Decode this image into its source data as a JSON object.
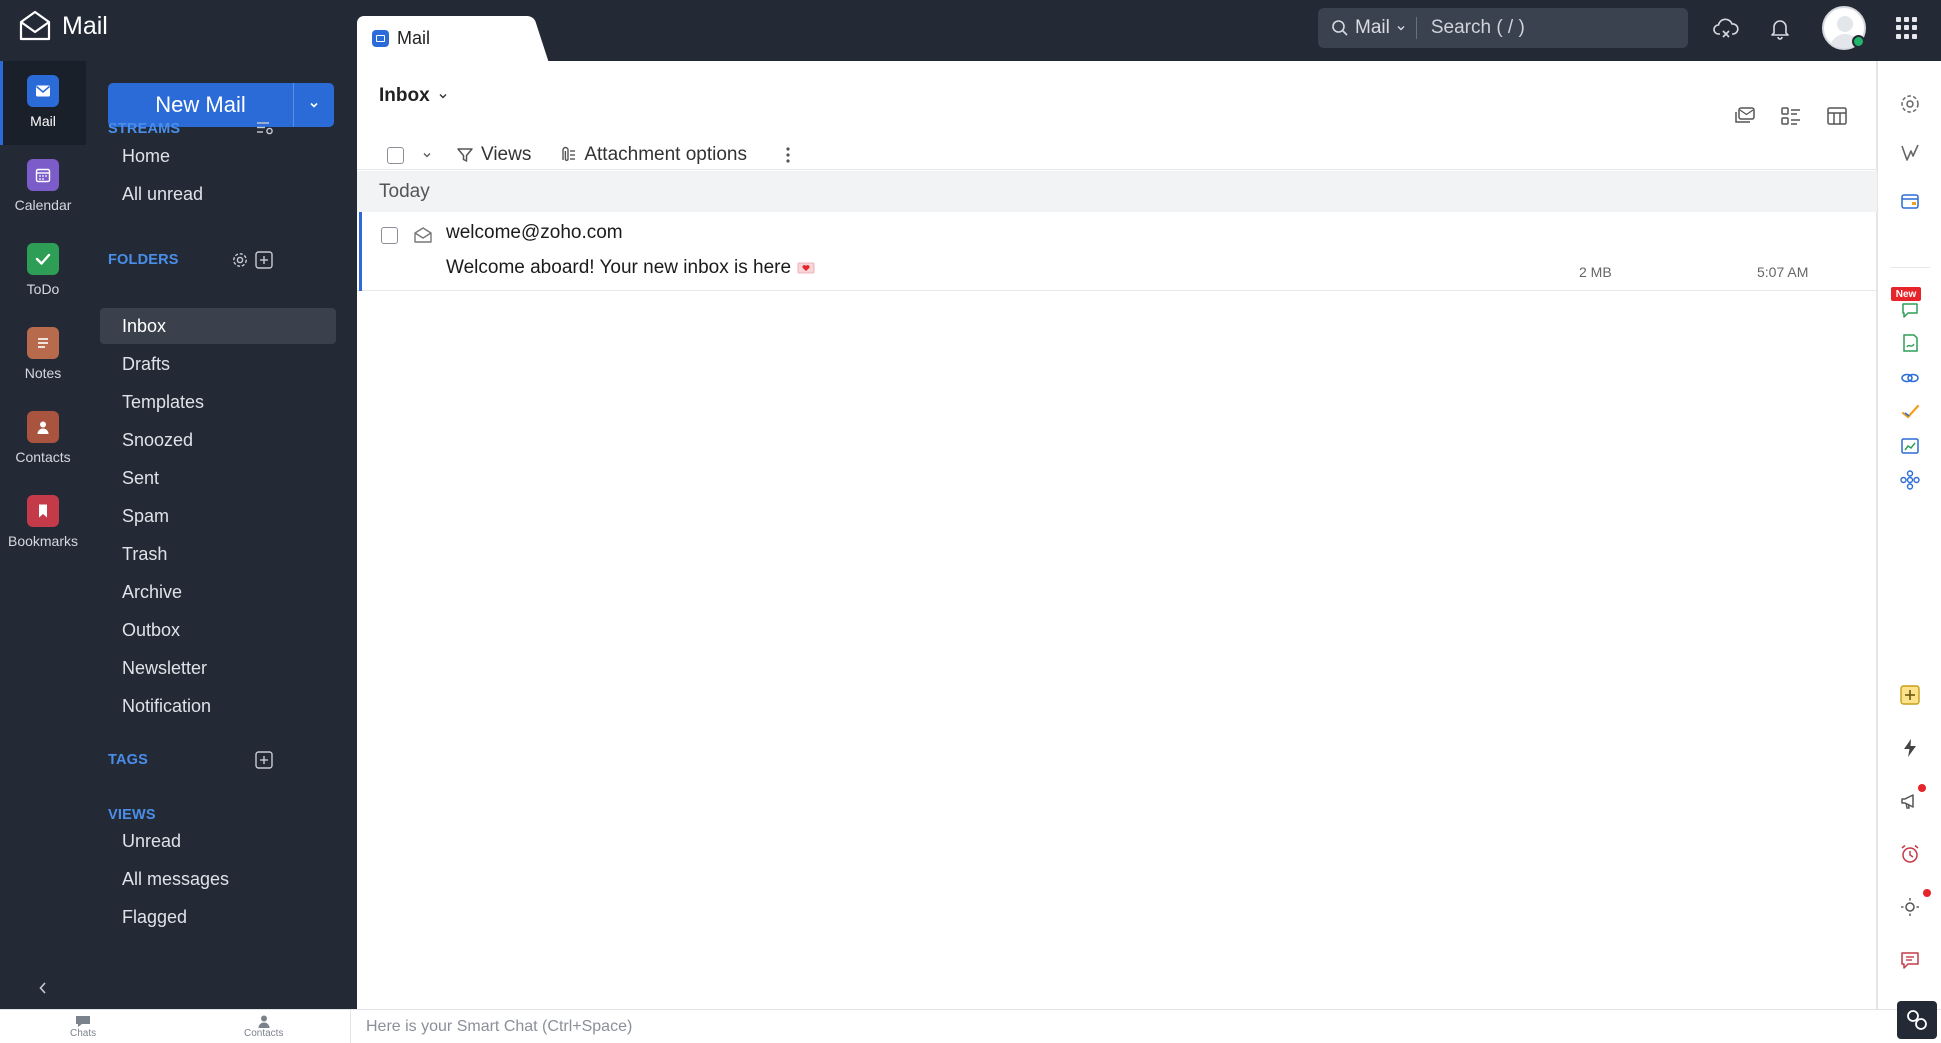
{
  "app": {
    "title": "Mail"
  },
  "tab": {
    "label": "Mail"
  },
  "search": {
    "scope": "Mail",
    "placeholder": "Search ( / )"
  },
  "rail": [
    {
      "label": "Mail",
      "icon": "mail-icon",
      "color": "#2b6bd8"
    },
    {
      "label": "Calendar",
      "icon": "calendar-icon",
      "color": "#7b5cc8"
    },
    {
      "label": "ToDo",
      "icon": "checkmark-icon",
      "color": "#2e9e57"
    },
    {
      "label": "Notes",
      "icon": "notes-icon",
      "color": "#b86a4c"
    },
    {
      "label": "Contacts",
      "icon": "contact-icon",
      "color": "#a9543f"
    },
    {
      "label": "Bookmarks",
      "icon": "bookmark-icon",
      "color": "#c43a48"
    }
  ],
  "new_mail": {
    "label": "New Mail"
  },
  "sections": {
    "streams": "STREAMS",
    "folders": "FOLDERS",
    "tags": "TAGS",
    "views": "VIEWS"
  },
  "streams": [
    "Home",
    "All unread"
  ],
  "folders": [
    "Inbox",
    "Drafts",
    "Templates",
    "Snoozed",
    "Sent",
    "Spam",
    "Trash",
    "Archive",
    "Outbox",
    "Newsletter",
    "Notification"
  ],
  "views": [
    "Unread",
    "All messages",
    "Flagged"
  ],
  "selected_folder": "Inbox",
  "main": {
    "title": "Inbox",
    "toolbar": {
      "views": "Views",
      "attachment": "Attachment options"
    },
    "group": "Today",
    "messages": [
      {
        "from": "welcome@zoho.com",
        "subject": "Welcome aboard! Your new inbox is here",
        "size": "2 MB",
        "time": "5:07 AM"
      }
    ]
  },
  "bottom": {
    "chats": "Chats",
    "contacts": "Contacts",
    "smart_chat": "Here is your Smart Chat (Ctrl+Space)"
  },
  "colors": {
    "sidebar": "#232a36",
    "accent": "#2b6bd8",
    "section": "#4a8eea",
    "notification": "#e5252a"
  }
}
